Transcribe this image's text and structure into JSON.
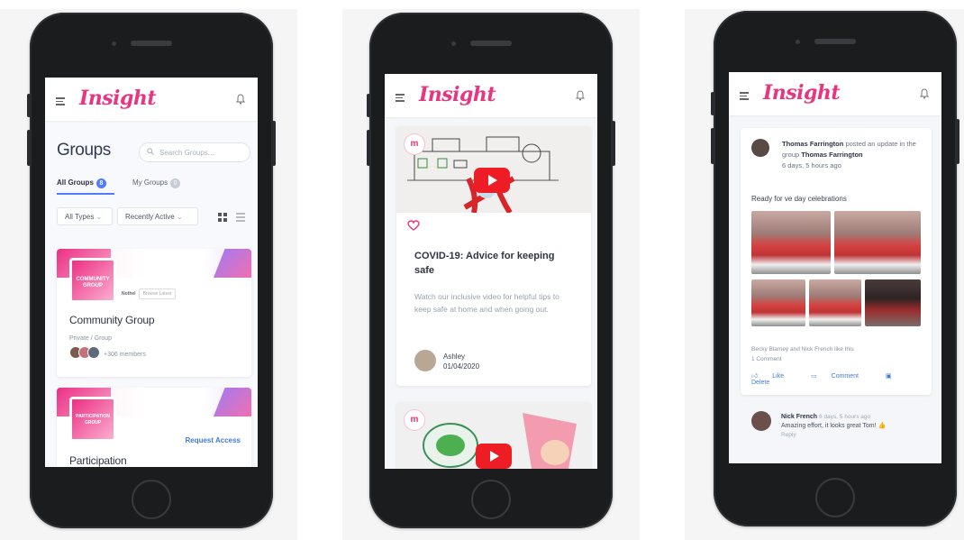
{
  "colors": {
    "brand": "#e8357f",
    "accent": "#4f7cff",
    "link": "#3e7bd9",
    "play": "#ee1c24"
  },
  "app": {
    "logo": "Insight",
    "menu_icon": "hamburger-icon",
    "bell_icon": "bell-icon"
  },
  "groups_screen": {
    "title": "Groups",
    "search_placeholder": "Search Groups...",
    "tabs": [
      {
        "label": "All Groups",
        "count": "8"
      },
      {
        "label": "My Groups",
        "count": "0"
      }
    ],
    "filter_type": "All Types",
    "filter_order": "Recently Active",
    "cards": [
      {
        "name": "Community Group",
        "badge": "COMMUNITY GROUP",
        "meta": "Private / Group",
        "members": "+306 members",
        "mini_label": "Nothel",
        "mini_button": "Browse Latest"
      },
      {
        "name": "Participation",
        "badge": "PARTICIPATION GROUP",
        "action": "Request Access"
      }
    ]
  },
  "video_screen": {
    "cards": [
      {
        "title": "COVID-19: Advice for keeping safe",
        "description": "Watch our inclusive video for helpful tips to keep safe at home and when going out.",
        "author": "Ashley",
        "date": "01/04/2020",
        "channel_glyph": "m"
      },
      {
        "channel_glyph": "m"
      }
    ]
  },
  "feed_screen": {
    "post": {
      "author": "Thomas Farrington",
      "action": "posted an update in the group",
      "group": "Thomas Farrington",
      "time": "6 days, 5 hours ago",
      "text": "Ready for ve day celebrations",
      "likes": "Becky Blamey and Nick French like this",
      "comments": "1 Comment",
      "actions": [
        "Like",
        "Comment",
        "Delete"
      ]
    },
    "comment": {
      "author": "Nick French",
      "time": "6 days, 5 hours ago",
      "text": "Amazing effort, it looks great Tom! 👍",
      "reply": "Reply"
    }
  }
}
